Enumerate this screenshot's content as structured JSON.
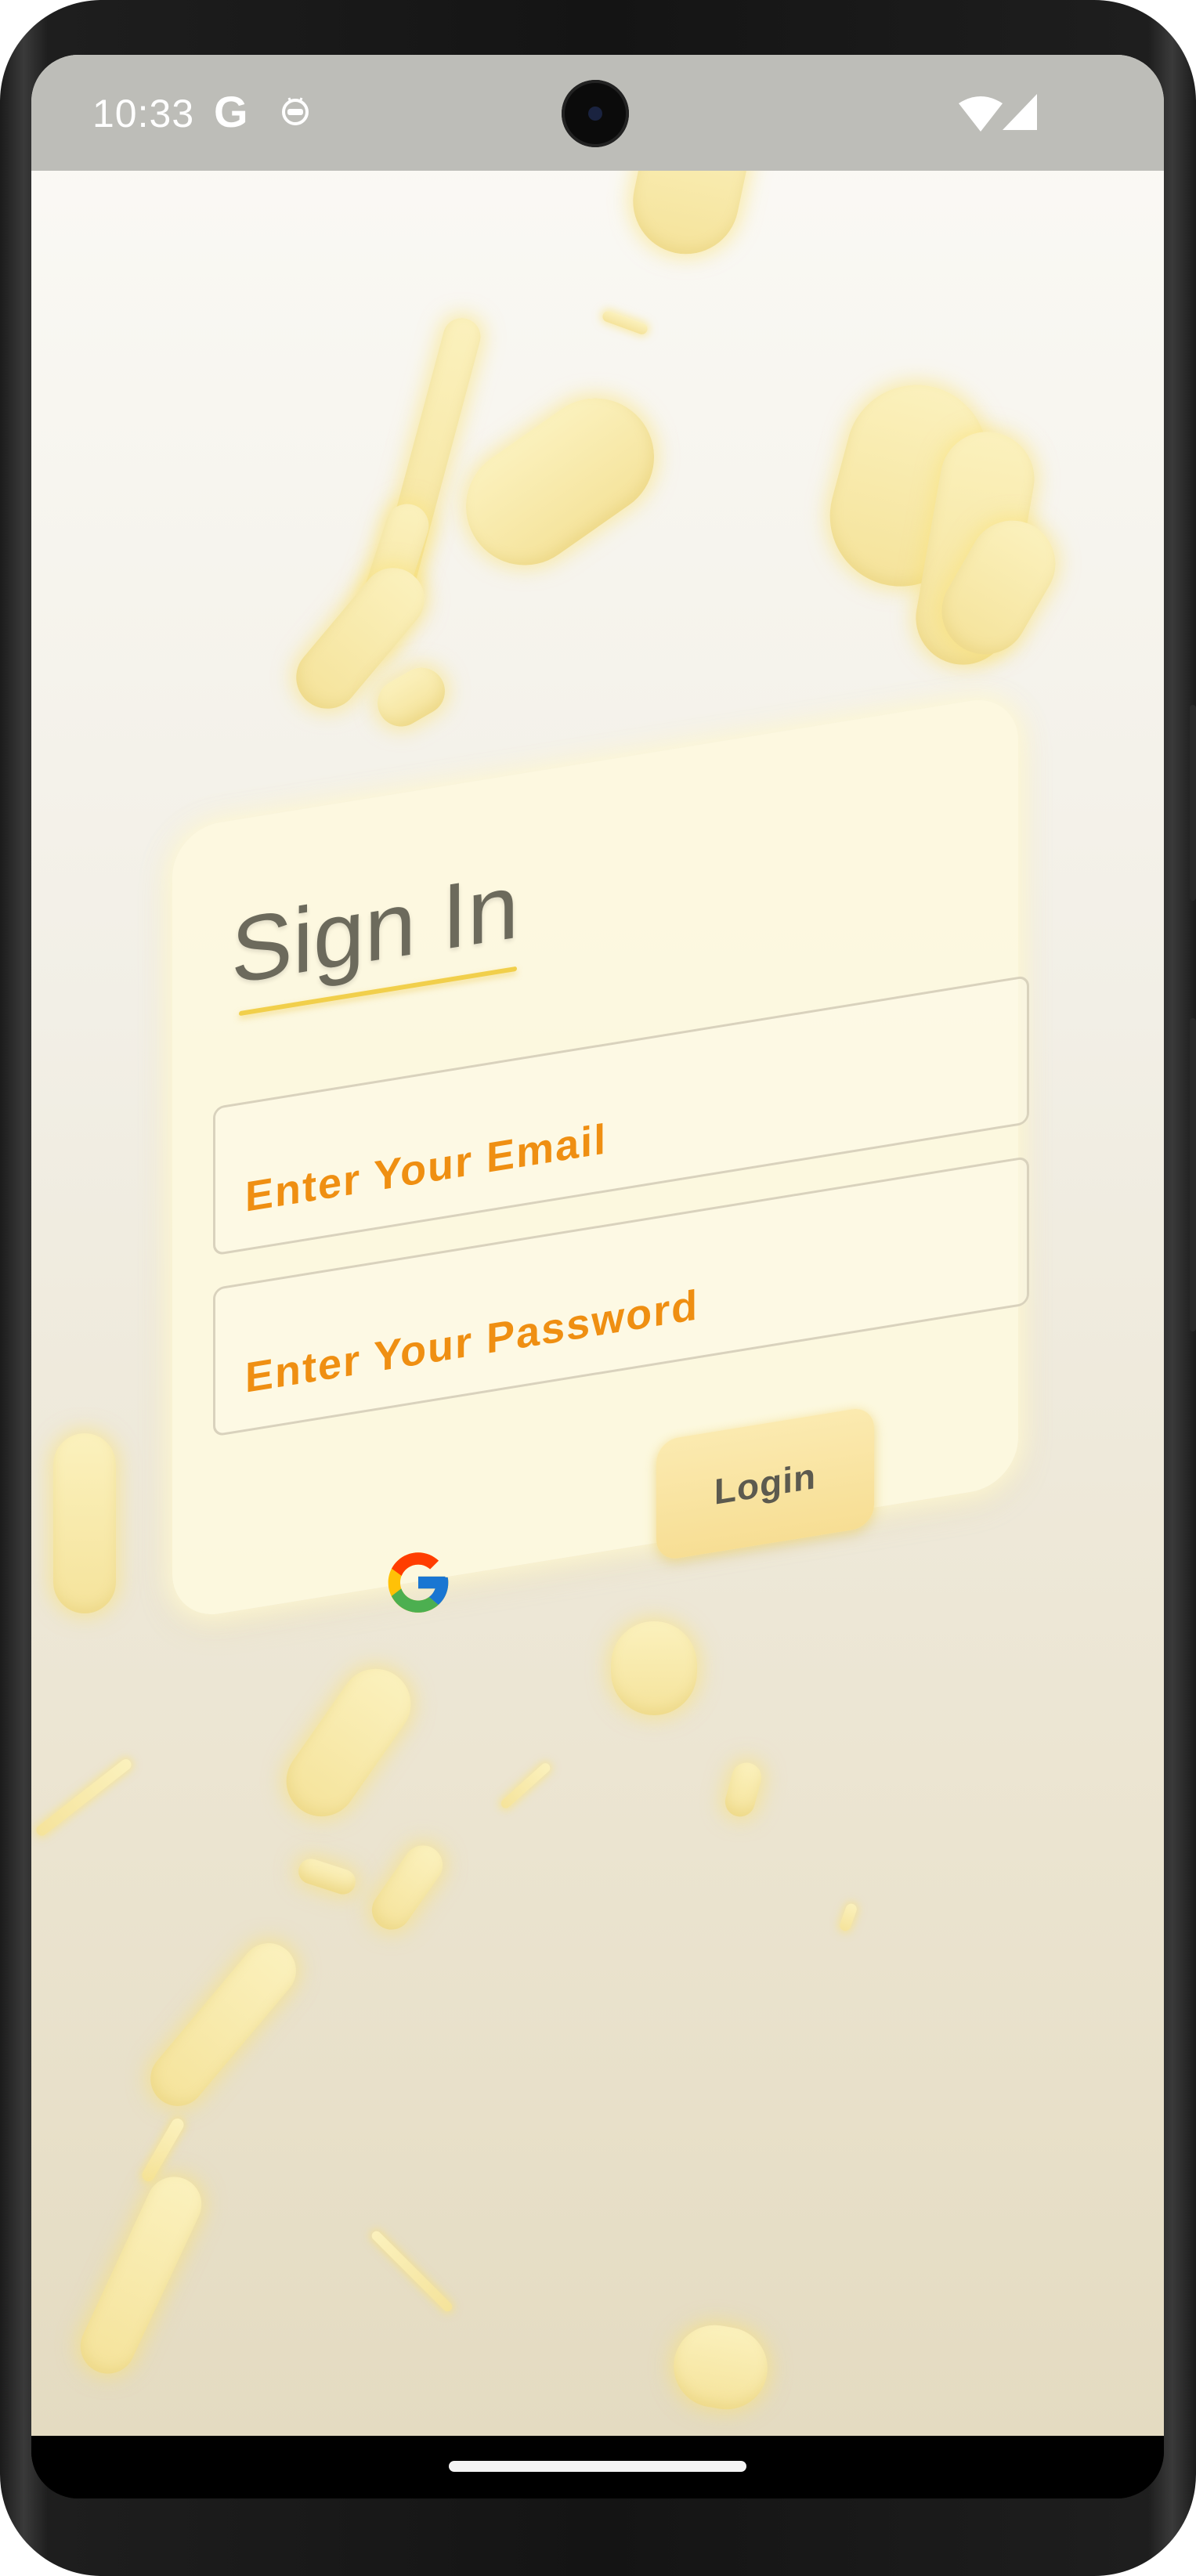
{
  "status_bar": {
    "time": "10:33",
    "notification_g": "G",
    "icons": [
      "google-icon",
      "bot-icon",
      "camera-icon",
      "wifi-icon",
      "signal-icon"
    ]
  },
  "login_card": {
    "title": "Sign In",
    "email": {
      "placeholder": "Enter Your Email",
      "value": ""
    },
    "password": {
      "placeholder": "Enter Your Password",
      "value": ""
    },
    "login_label": "Login",
    "google_icon": "google-g-icon"
  },
  "colors": {
    "placeholder": "#ef8f12",
    "title": "#6c6a5c",
    "accent_underline": "#f1cf4b",
    "pill": "#f5e39b"
  }
}
